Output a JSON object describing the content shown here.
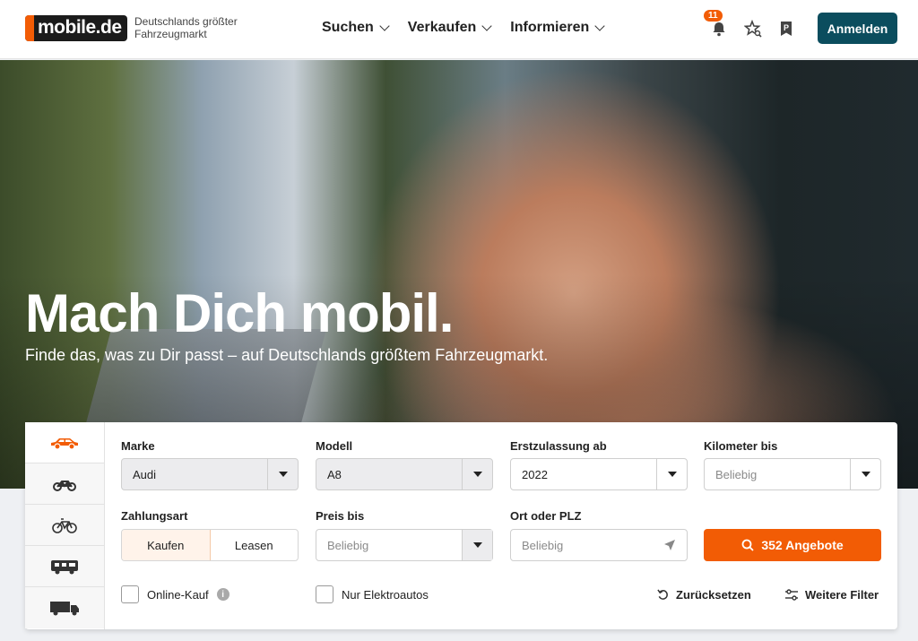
{
  "header": {
    "logo_text": "mobile.de",
    "tagline": "Deutschlands größter Fahrzeugmarkt",
    "nav": [
      "Suchen",
      "Verkaufen",
      "Informieren"
    ],
    "notification_count": "11",
    "login_label": "Anmelden"
  },
  "hero": {
    "title": "Mach Dich mobil.",
    "subtitle": "Finde das, was zu Dir passt – auf Deutschlands größtem Fahrzeugmarkt."
  },
  "vehicle_tabs": [
    "car-icon",
    "motorcycle-icon",
    "bicycle-icon",
    "motorhome-icon",
    "truck-icon"
  ],
  "search": {
    "marke": {
      "label": "Marke",
      "value": "Audi"
    },
    "modell": {
      "label": "Modell",
      "value": "A8"
    },
    "erstzulassung": {
      "label": "Erstzulassung ab",
      "value": "2022"
    },
    "kilometer": {
      "label": "Kilometer bis",
      "placeholder": "Beliebig"
    },
    "zahlungsart": {
      "label": "Zahlungsart",
      "options": [
        "Kaufen",
        "Leasen"
      ],
      "selected": "Kaufen"
    },
    "preis": {
      "label": "Preis bis",
      "placeholder": "Beliebig"
    },
    "ort": {
      "label": "Ort oder PLZ",
      "placeholder": "Beliebig"
    },
    "submit_label": "352 Angebote",
    "online_kauf_label": "Online-Kauf",
    "elektro_label": "Nur Elektroautos",
    "reset_label": "Zurücksetzen",
    "more_filters_label": "Weitere Filter"
  },
  "colors": {
    "accent": "#f25c05",
    "primary": "#0b4d5e"
  }
}
